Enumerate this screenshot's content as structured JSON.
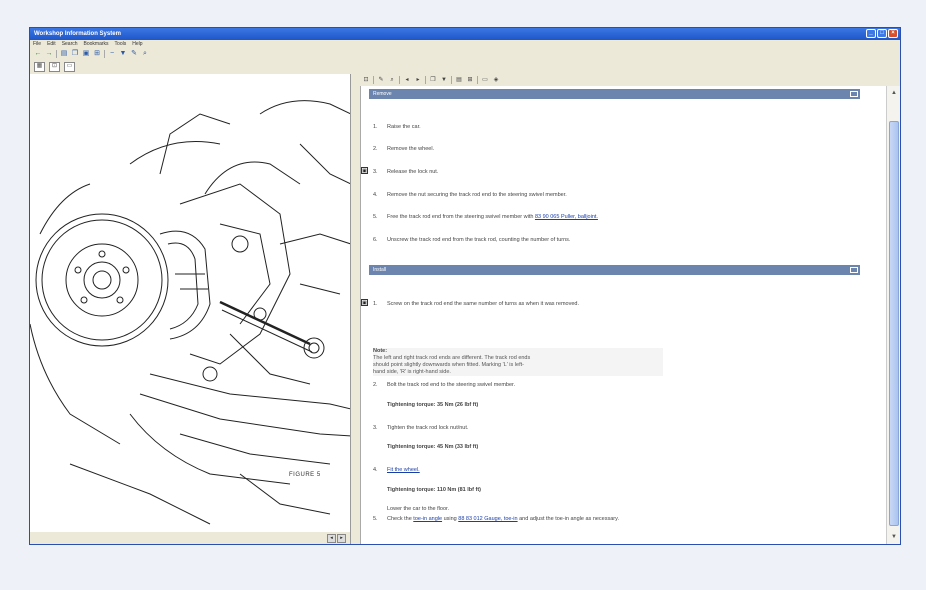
{
  "window": {
    "title": "Workshop Information System",
    "buttons": [
      "_",
      "□",
      "×"
    ]
  },
  "menu": [
    "File",
    "Edit",
    "Search",
    "Bookmarks",
    "Tools",
    "Help"
  ],
  "toolbar_icons": [
    "back-arrow-icon",
    "forward-arrow-icon",
    "print-icon",
    "copy-icon",
    "print-preview-icon",
    "zoom-icon",
    "minus-icon",
    "filter-icon",
    "edit-icon",
    "find-icon"
  ],
  "figure": {
    "label": "FIGURE 5"
  },
  "sections": [
    {
      "heading": "Remove"
    },
    {
      "heading": "Install"
    }
  ],
  "remove_steps": [
    {
      "num": "1.",
      "text": "Raise the car."
    },
    {
      "num": "2.",
      "text": "Remove the wheel."
    },
    {
      "num": "3.",
      "text": "Release the lock nut."
    },
    {
      "num": "4.",
      "text": "Remove the nut securing the track rod end to the steering swivel member."
    },
    {
      "num": "5.",
      "text": "Free the track rod end from the steering swivel member with ",
      "link": "83 90 065 Puller, balljoint."
    },
    {
      "num": "6.",
      "text": "Unscrew the track rod end from the track rod, counting the number of turns."
    }
  ],
  "install_step1": {
    "num": "1.",
    "text": "Screw on the track rod end the same number of turns as when it was removed."
  },
  "note": {
    "title": "Note:",
    "lines": [
      "The left and right track rod ends are different. The track rod ends",
      "should point slightly downwards when fitted. Marking 'L' is left-",
      "hand side, 'R' is right-hand side."
    ]
  },
  "install_steps": [
    {
      "num": "2.",
      "text": "Bolt the track rod end to the steering swivel member."
    },
    {
      "bold": "Tightening torque: 35 Nm (26 lbf ft)"
    },
    {
      "num": "3.",
      "text": "Tighten the track rod lock nut/nut."
    },
    {
      "bold": "Tightening torque: 45 Nm (33 lbf ft)"
    },
    {
      "num": "4.",
      "link": "Fit the wheel."
    },
    {
      "bold": "Tightening torque: 110 Nm (81 lbf ft)"
    },
    {
      "text": "Lower the car to the floor."
    },
    {
      "num": "5.",
      "text": "Check the ",
      "link": "toe-in angle",
      "text2": " using ",
      "link2": "88 83 012 Gauge, toe-in",
      "text3": " and adjust the toe-in angle as necessary."
    }
  ]
}
